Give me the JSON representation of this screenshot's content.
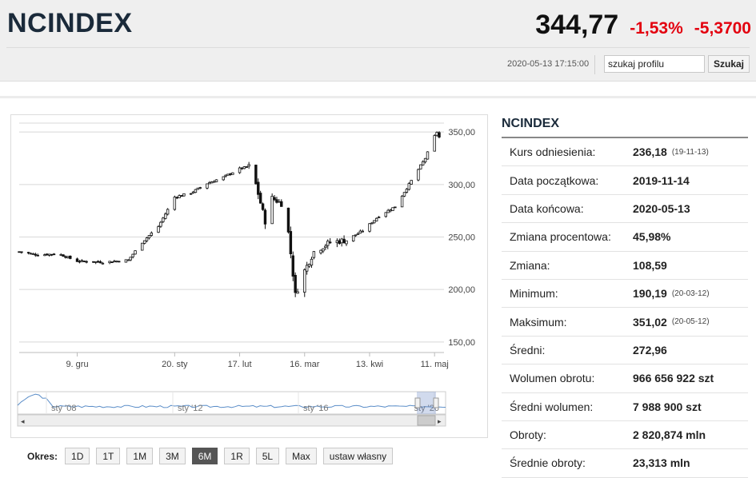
{
  "header": {
    "title": "NCINDEX",
    "price": "344,77",
    "change_pct": "-1,53%",
    "change_abs": "-5,3700",
    "datetime": "2020-05-13 17:15:00",
    "search_value": "szukaj profilu",
    "search_button": "Szukaj"
  },
  "periods": {
    "label": "Okres:",
    "active": "6M",
    "buttons": [
      "1D",
      "1T",
      "1M",
      "3M",
      "6M",
      "1R",
      "5L",
      "Max",
      "ustaw własny"
    ]
  },
  "stats": {
    "title": "NCINDEX",
    "rows": [
      {
        "label": "Kurs odniesienia:",
        "value": "236,18",
        "sub": "(19-11-13)"
      },
      {
        "label": "Data początkowa:",
        "value": "2019-11-14",
        "sub": ""
      },
      {
        "label": "Data końcowa:",
        "value": "2020-05-13",
        "sub": ""
      },
      {
        "label": "Zmiana procentowa:",
        "value": "45,98%",
        "sub": ""
      },
      {
        "label": "Zmiana:",
        "value": "108,59",
        "sub": ""
      },
      {
        "label": "Minimum:",
        "value": "190,19",
        "sub": "(20-03-12)"
      },
      {
        "label": "Maksimum:",
        "value": "351,02",
        "sub": "(20-05-12)"
      },
      {
        "label": "Średni:",
        "value": "272,96",
        "sub": ""
      },
      {
        "label": "Wolumen obrotu:",
        "value": "966 656 922 szt",
        "sub": ""
      },
      {
        "label": "Średni wolumen:",
        "value": "7 988 900 szt",
        "sub": ""
      },
      {
        "label": "Obroty:",
        "value": "2 820,874 mln",
        "sub": ""
      },
      {
        "label": "Średnie obroty:",
        "value": "23,313 mln",
        "sub": ""
      }
    ]
  },
  "chart_data": {
    "type": "candlestick",
    "ylim": [
      140,
      360
    ],
    "y_ticks": [
      "150,00",
      "200,00",
      "250,00",
      "300,00",
      "350,00"
    ],
    "y_tick_values": [
      150,
      200,
      250,
      300,
      350
    ],
    "x_ticks": [
      "9. gru",
      "20. sty",
      "17. lut",
      "16. mar",
      "13. kwi",
      "11. maj"
    ],
    "x_tick_dates": [
      "2019-12-09",
      "2020-01-20",
      "2020-02-17",
      "2020-03-16",
      "2020-04-13",
      "2020-05-11"
    ],
    "x_range": [
      "2019-11-14",
      "2020-05-13"
    ],
    "anchors": [
      [
        "2019-11-14",
        236
      ],
      [
        "2019-11-22",
        233
      ],
      [
        "2019-12-01",
        234
      ],
      [
        "2019-12-09",
        227
      ],
      [
        "2019-12-20",
        226
      ],
      [
        "2019-12-31",
        228
      ],
      [
        "2020-01-06",
        245
      ],
      [
        "2020-01-13",
        260
      ],
      [
        "2020-01-20",
        288
      ],
      [
        "2020-01-27",
        292
      ],
      [
        "2020-02-03",
        301
      ],
      [
        "2020-02-10",
        307
      ],
      [
        "2020-02-17",
        315
      ],
      [
        "2020-02-21",
        317
      ],
      [
        "2020-02-24",
        300
      ],
      [
        "2020-02-28",
        265
      ],
      [
        "2020-03-02",
        287
      ],
      [
        "2020-03-06",
        282
      ],
      [
        "2020-03-09",
        254
      ],
      [
        "2020-03-12",
        195
      ],
      [
        "2020-03-16",
        218
      ],
      [
        "2020-03-20",
        236
      ],
      [
        "2020-03-27",
        245
      ],
      [
        "2020-04-03",
        247
      ],
      [
        "2020-04-10",
        256
      ],
      [
        "2020-04-17",
        270
      ],
      [
        "2020-04-24",
        279
      ],
      [
        "2020-04-30",
        300
      ],
      [
        "2020-05-07",
        325
      ],
      [
        "2020-05-11",
        346
      ],
      [
        "2020-05-12",
        350
      ],
      [
        "2020-05-13",
        345
      ]
    ],
    "navigator": {
      "x_labels": [
        "sty '08",
        "sty '12",
        "sty '16",
        "sty '20"
      ]
    }
  }
}
